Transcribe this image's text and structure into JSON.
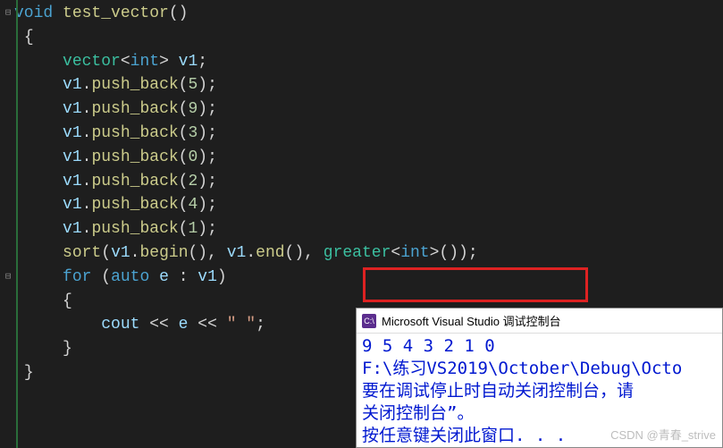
{
  "code": {
    "l1_kw": "void ",
    "l1_fn": "test_vector",
    "l1_paren": "()",
    "l2": "{",
    "l3_sp": "    ",
    "l3_type": "vector",
    "l3_tpl_open": "<",
    "l3_kw_int": "int",
    "l3_tpl_close": "> ",
    "l3_var": "v1",
    "l3_end": ";",
    "push": [
      {
        "sp": "    ",
        "var": "v1",
        "dot": ".",
        "fn": "push_back",
        "open": "(",
        "num": "5",
        "close": ");"
      },
      {
        "sp": "    ",
        "var": "v1",
        "dot": ".",
        "fn": "push_back",
        "open": "(",
        "num": "9",
        "close": ");"
      },
      {
        "sp": "    ",
        "var": "v1",
        "dot": ".",
        "fn": "push_back",
        "open": "(",
        "num": "3",
        "close": ");"
      },
      {
        "sp": "    ",
        "var": "v1",
        "dot": ".",
        "fn": "push_back",
        "open": "(",
        "num": "0",
        "close": ");"
      },
      {
        "sp": "    ",
        "var": "v1",
        "dot": ".",
        "fn": "push_back",
        "open": "(",
        "num": "2",
        "close": ");"
      },
      {
        "sp": "    ",
        "var": "v1",
        "dot": ".",
        "fn": "push_back",
        "open": "(",
        "num": "4",
        "close": ");"
      },
      {
        "sp": "    ",
        "var": "v1",
        "dot": ".",
        "fn": "push_back",
        "open": "(",
        "num": "1",
        "close": ");"
      }
    ],
    "sort_sp": "    ",
    "sort_fn": "sort",
    "sort_open": "(",
    "sort_v1a": "v1",
    "sort_dot1": ".",
    "sort_begin": "begin",
    "sort_p1": "(), ",
    "sort_v1b": "v1",
    "sort_dot2": ".",
    "sort_end": "end",
    "sort_p2": "(), ",
    "sort_greater": "greater",
    "sort_t_open": "<",
    "sort_int": "int",
    "sort_t_close": ">",
    "sort_close": "());",
    "for_sp": "    ",
    "for_kw": "for ",
    "for_open": "(",
    "for_auto": "auto ",
    "for_e": "e",
    "for_colon": " : ",
    "for_v1": "v1",
    "for_close": ")",
    "body_open_sp": "    ",
    "body_open": "{",
    "cout_sp": "        ",
    "cout_var": "cout",
    "cout_op1": " << ",
    "cout_e": "e",
    "cout_op2": " << ",
    "cout_str": "\" \"",
    "cout_end": ";",
    "body_close_sp": "    ",
    "body_close": "}",
    "fn_close": "}"
  },
  "console": {
    "icon_text": "C:\\",
    "title": "Microsoft Visual Studio 调试控制台",
    "line1": "9 5 4 3 2 1 0",
    "line2": "F:\\练习VS2019\\October\\Debug\\Octo",
    "line3": "要在调试停止时自动关闭控制台，请",
    "line4": "关闭控制台”。",
    "line5": "按任意键关闭此窗口. . ."
  },
  "watermark": "CSDN @青春_strive",
  "fold": {
    "minus": "⊟",
    "plus": "⊞"
  }
}
